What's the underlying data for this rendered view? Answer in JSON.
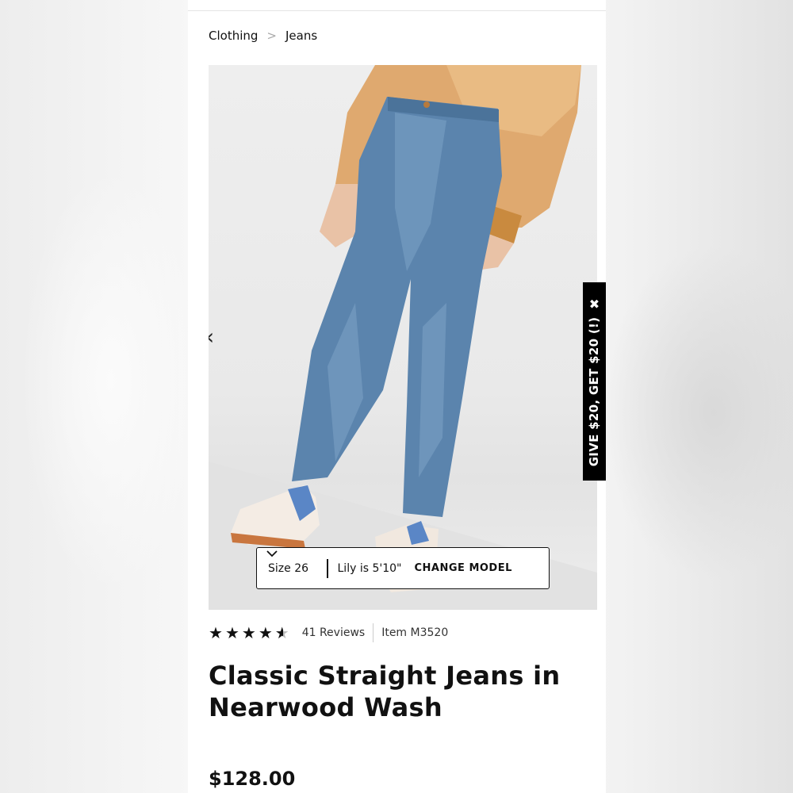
{
  "breadcrumb": {
    "items": [
      "Clothing",
      "Jeans"
    ],
    "separator": ">"
  },
  "hero": {
    "prev_arrow": "‹",
    "model_bar": {
      "size_label": "Size 26",
      "model_label": "Lily is 5'10\"",
      "change_label": "CHANGE MODEL"
    }
  },
  "promo": {
    "text": "GIVE $20, GET $20 (!)",
    "close": "✖"
  },
  "product": {
    "rating_value": 4.5,
    "reviews_label": "41 Reviews",
    "item_label": "Item M3520",
    "title": "Classic Straight Jeans in Nearwood Wash",
    "price": "$128.00"
  },
  "colors": {
    "denim": "#5b84ad",
    "sweater": "#dba56c",
    "promo_bg": "#000000"
  }
}
